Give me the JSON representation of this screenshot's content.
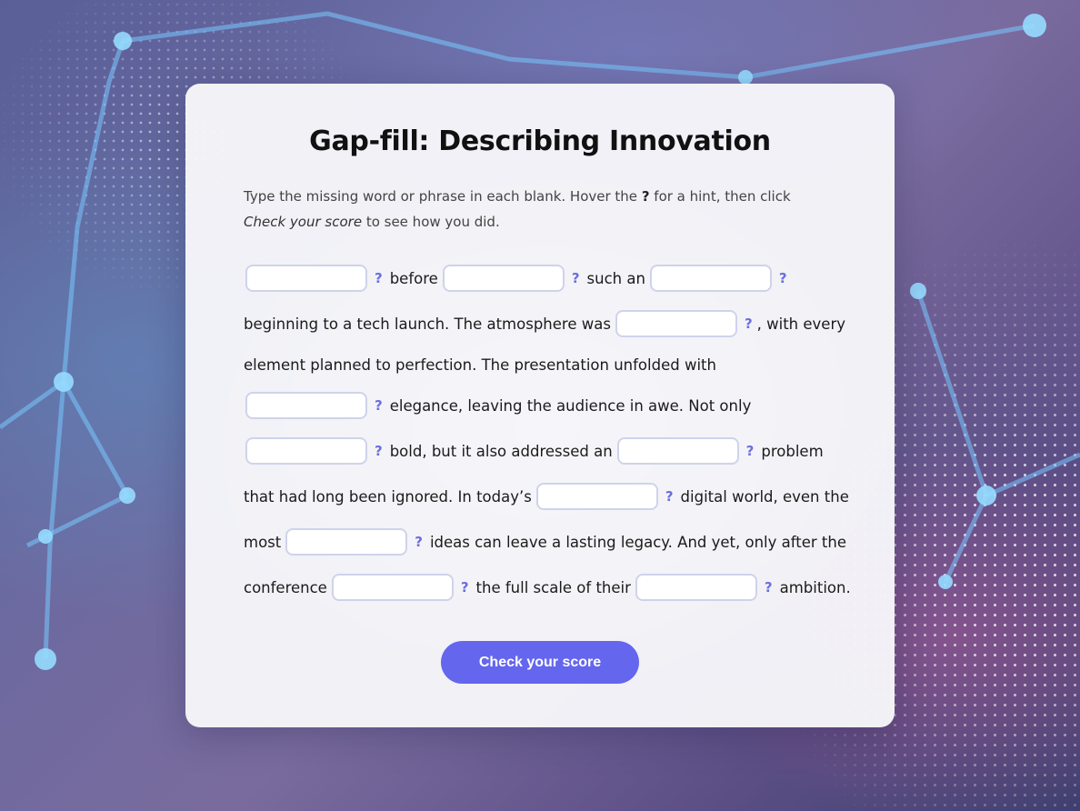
{
  "title": "Gap-fill: Describing Innovation",
  "instructions": {
    "part1": "Type the missing word or phrase in each blank. Hover the ",
    "hint_symbol": "?",
    "part2": " for a hint, then click",
    "check_ref": "Check your score",
    "part3": " to see how you did."
  },
  "hint_symbol": "?",
  "passage": {
    "t1": "before",
    "t2": "such an",
    "t3": "beginning to a tech launch. The atmosphere was",
    "t4": ", with every",
    "t5": "element planned to perfection. The presentation unfolded with",
    "t6": "elegance, leaving the audience in awe. Not only",
    "t7": "bold, but it also addressed an",
    "t8": "problem",
    "t9": "that had long been ignored. In today’s",
    "t10": "digital world, even the",
    "t11": "most",
    "t12": "ideas can leave a lasting legacy. And yet, only after the",
    "t13": "conference",
    "t14": "the full scale of their",
    "t15": "ambition."
  },
  "gaps": [
    {
      "value": ""
    },
    {
      "value": ""
    },
    {
      "value": ""
    },
    {
      "value": ""
    },
    {
      "value": ""
    },
    {
      "value": ""
    },
    {
      "value": ""
    },
    {
      "value": ""
    },
    {
      "value": ""
    },
    {
      "value": ""
    },
    {
      "value": ""
    },
    {
      "value": ""
    }
  ],
  "check_button": "Check your score",
  "colors": {
    "accent": "#6466ee",
    "hint": "#6b6ee0",
    "gap_border": "#cfd3ea",
    "card": "#f7f7fa"
  }
}
